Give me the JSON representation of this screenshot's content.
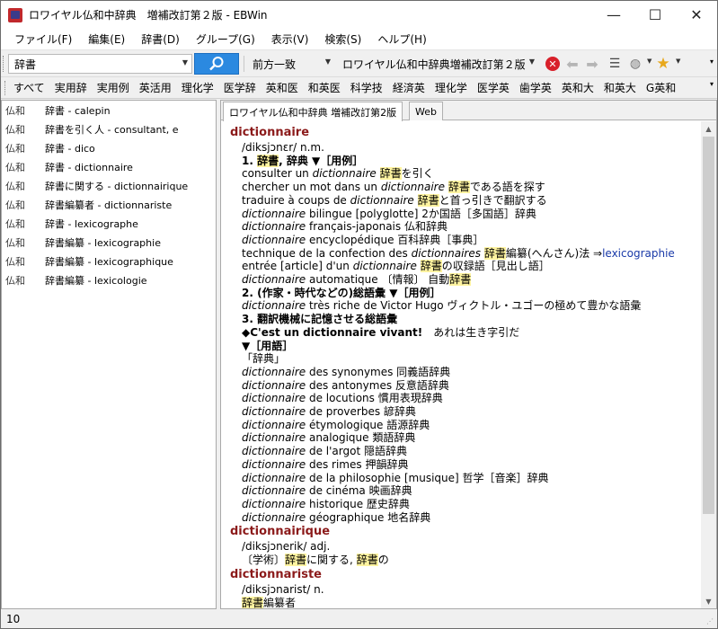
{
  "window": {
    "title": "ロワイヤル仏和中辞典　増補改訂第２版 - EBWin",
    "minimize": "—",
    "maximize": "☐",
    "close": "✕"
  },
  "menu": [
    "ファイル(F)",
    "編集(E)",
    "辞書(D)",
    "グループ(G)",
    "表示(V)",
    "検索(S)",
    "ヘルプ(H)"
  ],
  "toolbar": {
    "search_value": "辞書",
    "search_mode": "前方一致",
    "dictionary": "ロワイヤル仏和中辞典増補改訂第２版",
    "icons": [
      "search-icon",
      "stop-icon",
      "back-arrow-icon",
      "forward-arrow-icon",
      "list-icon",
      "globe-icon",
      "star-icon"
    ]
  },
  "groups": [
    "すべて",
    "実用辞",
    "実用例",
    "英活用",
    "理化学",
    "医学辞",
    "英和医",
    "和英医",
    "科学技",
    "経済英",
    "理化学",
    "医学英",
    "歯学英",
    "英和大",
    "和英大",
    "G英和"
  ],
  "results": [
    {
      "book": "仏和",
      "head": "辞書 - calepin"
    },
    {
      "book": "仏和",
      "head": "辞書を引く人 - consultant, e"
    },
    {
      "book": "仏和",
      "head": "辞書 - dico"
    },
    {
      "book": "仏和",
      "head": "辞書 - dictionnaire"
    },
    {
      "book": "仏和",
      "head": "辞書に関する - dictionnairique"
    },
    {
      "book": "仏和",
      "head": "辞書編纂者 - dictionnariste"
    },
    {
      "book": "仏和",
      "head": "辞書 - lexicographe"
    },
    {
      "book": "仏和",
      "head": "辞書編纂 - lexicographie"
    },
    {
      "book": "仏和",
      "head": "辞書編纂 - lexicographique"
    },
    {
      "book": "仏和",
      "head": "辞書編纂 - lexicologie"
    }
  ],
  "tabs": [
    "ロワイヤル仏和中辞典 増補改訂第2版",
    "Web"
  ],
  "entry": {
    "hw1": "dictionnaire",
    "l1": "/diksjɔnɛr/ n.m.",
    "l2a": "1. ",
    "l2b": "辞書",
    "l2c": ", 辞典 ▼［用例］",
    "l3a": "consulter un ",
    "l3b": "dictionnaire",
    "l3c": " ",
    "l3d": "辞書",
    "l3e": "を引く",
    "l4a": "chercher un mot dans un ",
    "l4b": "dictionnaire",
    "l4c": " ",
    "l4d": "辞書",
    "l4e": "である語を探す",
    "l5a": "traduire à coups de ",
    "l5b": "dictionnaire",
    "l5c": " ",
    "l5d": "辞書",
    "l5e": "と首っ引きで翻訳する",
    "l6a": "dictionnaire",
    "l6b": " bilingue [polyglotte]  2か国語［多国語］辞典",
    "l7a": "dictionnaire",
    "l7b": " français-japonais 仏和辞典",
    "l8a": "dictionnaire",
    "l8b": " encyclopédique 百科辞典［事典］",
    "l9a": "technique de la confection des ",
    "l9b": "dictionnaires",
    "l9c": " ",
    "l9d": "辞書",
    "l9e": "編纂(へんさん)法 ⇒",
    "l9f": "lexicographie",
    "l10a": "entrée [article] d'un ",
    "l10b": "dictionnaire",
    "l10c": " ",
    "l10d": "辞書",
    "l10e": "の収録語［見出し語］",
    "l11a": "dictionnaire",
    "l11b": " automatique 〔情報〕 自動",
    "l11c": "辞書",
    "l12": "2. (作家・時代などの)総語彙 ▼［用例］",
    "l13a": "dictionnaire",
    "l13b": " très riche de Victor Hugo ヴィクトル・ユゴーの極めて豊かな語彙",
    "l14": "3. 翻訳機械に記憶させる総語彙",
    "l15a": "◆C'est un dictionnaire vivant!",
    "l15b": "　あれは生き字引だ",
    "l16": "▼［用語］",
    "l17": "「辞典」",
    "l18a": "dictionnaire",
    "l18b": " des synonymes 同義語辞典",
    "l19a": "dictionnaire",
    "l19b": " des antonymes 反意語辞典",
    "l20a": "dictionnaire",
    "l20b": " de locutions 慣用表現辞典",
    "l21a": "dictionnaire",
    "l21b": " de proverbes 諺辞典",
    "l22a": "dictionnaire",
    "l22b": " étymologique 語源辞典",
    "l23a": "dictionnaire",
    "l23b": " analogique 類語辞典",
    "l24a": "dictionnaire",
    "l24b": " de l'argot 隠語辞典",
    "l25a": "dictionnaire",
    "l25b": " des rimes 押韻辞典",
    "l26a": "dictionnaire",
    "l26b": " de la philosophie [musique] 哲学［音楽］辞典",
    "l27a": "dictionnaire",
    "l27b": " de cinéma 映画辞典",
    "l28a": "dictionnaire",
    "l28b": " historique 歴史辞典",
    "l29a": "dictionnaire",
    "l29b": " géographique 地名辞典",
    "hw2": "dictionnairique",
    "l30": "/diksjɔnerik/ adj.",
    "l31a": "〔学術〕",
    "l31b": "辞書",
    "l31c": "に関する, ",
    "l31d": "辞書",
    "l31e": "の",
    "hw3": "dictionnariste",
    "l32": "/diksjɔnarist/ n.",
    "l33a": "辞書",
    "l33b": "編纂者"
  },
  "status": {
    "count": "10"
  }
}
